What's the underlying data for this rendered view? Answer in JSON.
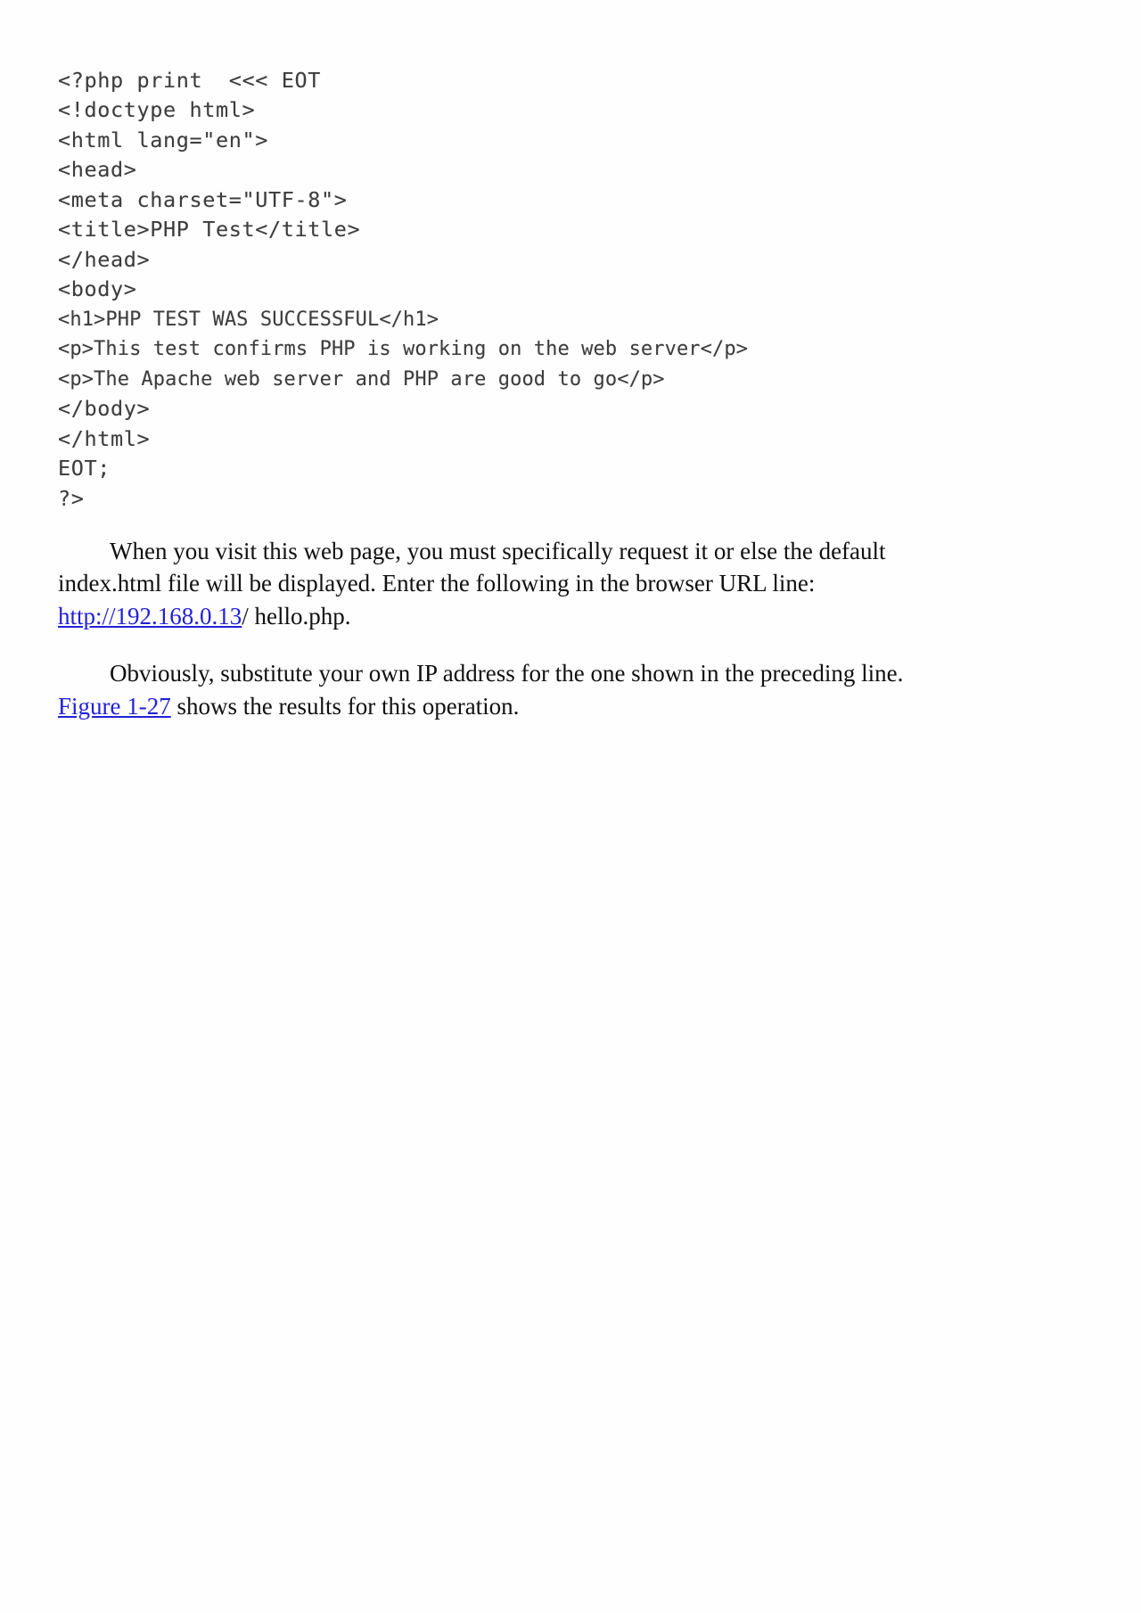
{
  "document": {
    "code_listing": {
      "language": "php",
      "lines": [
        "<?php print  <<< EOT",
        "<!doctype html>",
        "<html lang=\"en\">",
        "<head>",
        "<meta charset=\"UTF-8\">",
        "<title>PHP Test</title>",
        "</head>",
        "<body>",
        "<h1>PHP TEST WAS SUCCESSFUL</h1>",
        "<p>This test confirms PHP is working on the web server</p>",
        "<p>The Apache web server and PHP are good to go</p>",
        "</body>",
        "</html>",
        "EOT;",
        "?>"
      ]
    },
    "paragraphs": [
      {
        "id": "visit-page",
        "text_before_link": "When you visit this web page, you must specifically request it or else the default index.html file will be displayed. Enter the following in the browser URL line: ",
        "link_text": "http://192.168.0.13",
        "text_after_link": "/ hello.php."
      },
      {
        "id": "substitute-ip",
        "text_before_link": "Obviously, substitute your own IP address for the one shown in the preceding line. ",
        "link_text": "Figure 1-27",
        "text_after_link": " shows the results for this operation."
      }
    ],
    "colors": {
      "page_background": "#fefefe",
      "body_text": "#101010",
      "code_text": "#3d3d3d",
      "link": "#2320d8"
    }
  }
}
